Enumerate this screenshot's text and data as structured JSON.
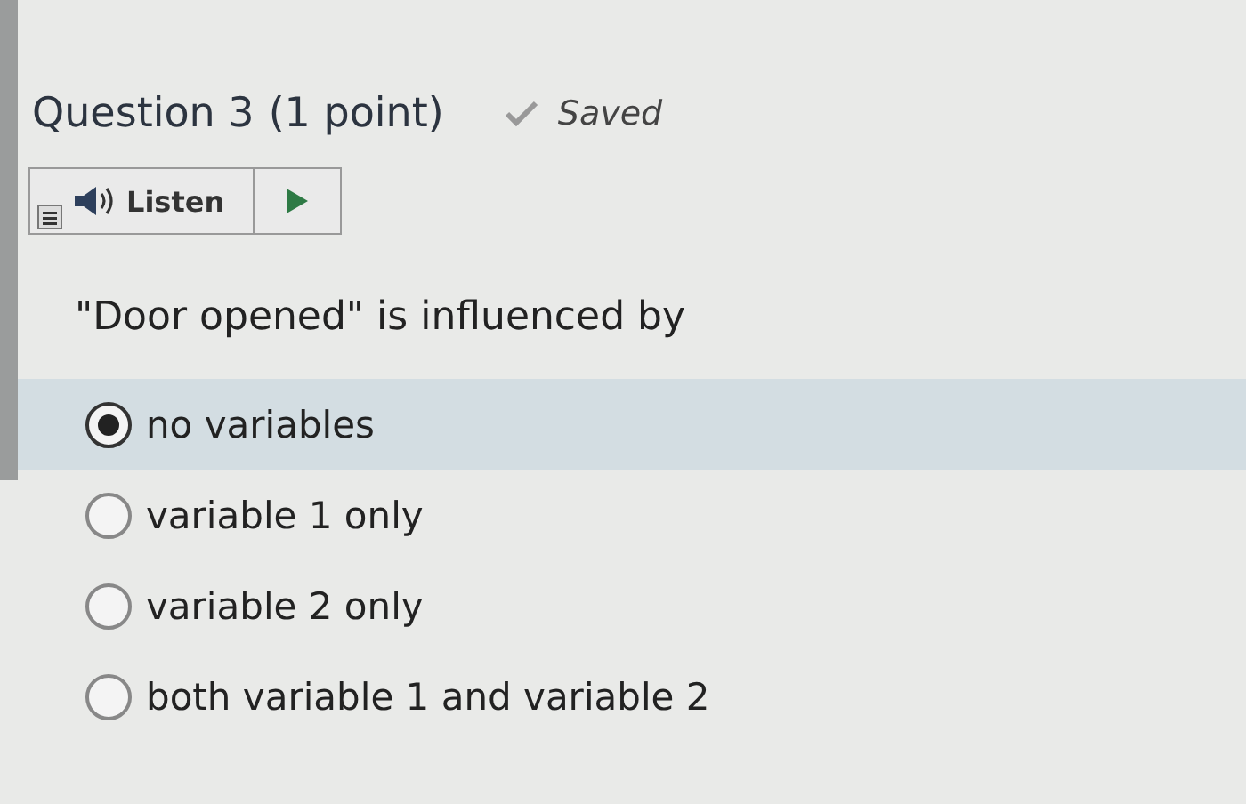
{
  "question": {
    "title": "Question 3",
    "points": "(1 point)",
    "status": "Saved"
  },
  "listen": {
    "label": "Listen"
  },
  "prompt": "\"Door opened\" is influenced by",
  "options": [
    {
      "label": "no variables",
      "selected": true
    },
    {
      "label": "variable 1 only",
      "selected": false
    },
    {
      "label": "variable 2 only",
      "selected": false
    },
    {
      "label": "both variable 1 and variable 2",
      "selected": false
    }
  ]
}
